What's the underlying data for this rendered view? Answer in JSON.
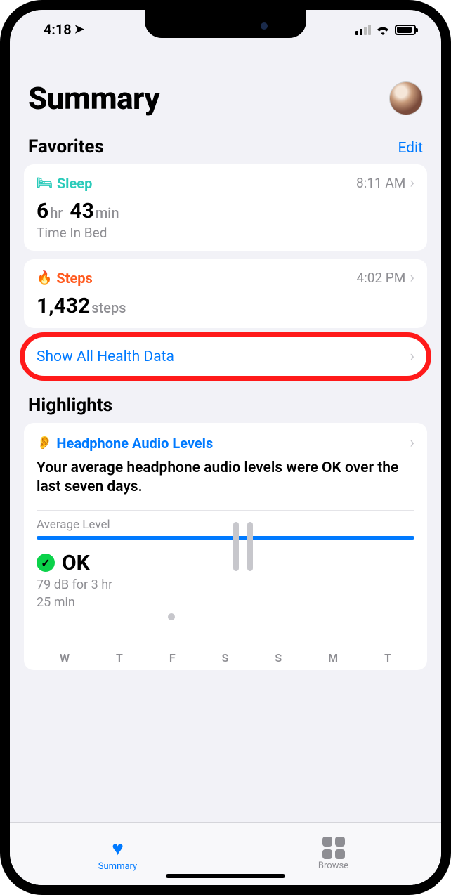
{
  "status": {
    "time": "4:18"
  },
  "header": {
    "title": "Summary"
  },
  "favorites": {
    "title": "Favorites",
    "edit": "Edit",
    "sleep": {
      "label": "Sleep",
      "time": "8:11 AM",
      "val_h": "6",
      "unit_h": "hr",
      "val_m": "43",
      "unit_m": "min",
      "sub": "Time In Bed"
    },
    "steps": {
      "label": "Steps",
      "time": "4:02 PM",
      "val": "1,432",
      "unit": "steps"
    },
    "showall": "Show All Health Data"
  },
  "highlights": {
    "title": "Highlights",
    "headphone": {
      "label": "Headphone Audio Levels",
      "desc": "Your average headphone audio levels were OK over the last seven days.",
      "avg_label": "Average Level",
      "ok": "OK",
      "ok_sub1": "79 dB for 3 hr",
      "ok_sub2": "25 min",
      "days": [
        "W",
        "T",
        "F",
        "S",
        "S",
        "M",
        "T"
      ]
    }
  },
  "tabs": {
    "summary": "Summary",
    "browse": "Browse"
  }
}
